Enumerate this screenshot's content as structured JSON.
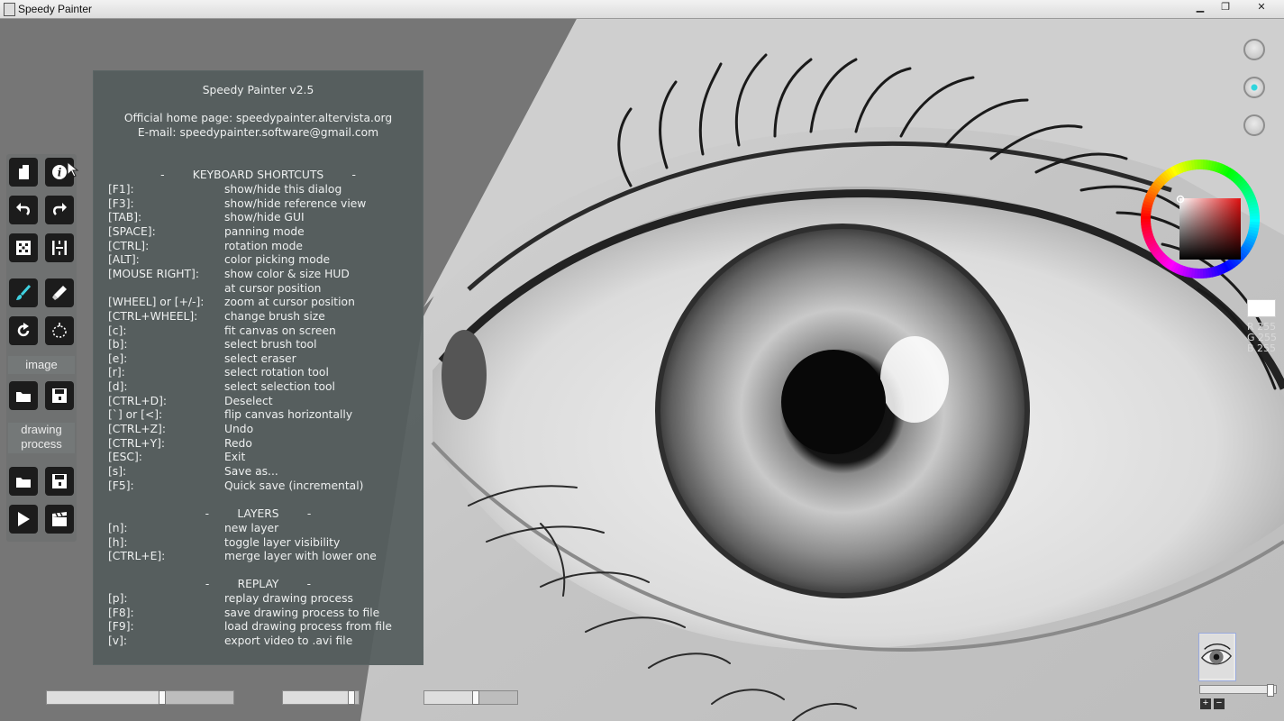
{
  "window": {
    "title": "Speedy Painter",
    "minimize": "▁",
    "restore": "❐",
    "close": "✕"
  },
  "toolbar": {
    "icons": [
      "new-canvas-icon",
      "info-icon",
      "undo-icon",
      "redo-icon",
      "grid-icon",
      "flip-icon",
      "brush-icon",
      "eraser-icon",
      "rotate-icon",
      "lasso-icon",
      "open-image-icon",
      "save-image-icon",
      "open-process-icon",
      "save-process-icon",
      "play-icon",
      "clapper-icon"
    ],
    "image_label": "image",
    "drawing_process_label_1": "drawing",
    "drawing_process_label_2": "process"
  },
  "dialog": {
    "title": "Speedy Painter v2.5",
    "homepage": "Official home page: speedypainter.altervista.org",
    "email": "E-mail: speedypainter.software@gmail.com",
    "keyboard_header": "-        KEYBOARD SHORTCUTS        -",
    "keyboard": [
      {
        "key": "[F1]:",
        "desc": "show/hide this dialog"
      },
      {
        "key": "[F3]:",
        "desc": "show/hide reference view"
      },
      {
        "key": "[TAB]:",
        "desc": "show/hide GUI"
      },
      {
        "key": "[SPACE]:",
        "desc": "panning mode"
      },
      {
        "key": "[CTRL]:",
        "desc": "rotation mode"
      },
      {
        "key": "[ALT]:",
        "desc": "color picking mode"
      },
      {
        "key": "[MOUSE RIGHT]:",
        "desc": "show color & size HUD"
      },
      {
        "key": "",
        "desc": "at cursor position"
      },
      {
        "key": "[WHEEL] or [+/-]:",
        "desc": "zoom at cursor position"
      },
      {
        "key": "[CTRL+WHEEL]:",
        "desc": "change brush size"
      },
      {
        "key": "[c]:",
        "desc": "fit canvas on screen"
      },
      {
        "key": "[b]:",
        "desc": "select brush tool"
      },
      {
        "key": "[e]:",
        "desc": "select eraser"
      },
      {
        "key": "[r]:",
        "desc": "select rotation tool"
      },
      {
        "key": "[d]:",
        "desc": "select selection tool"
      },
      {
        "key": "[CTRL+D]:",
        "desc": "Deselect"
      },
      {
        "key": "[`] or [<]:",
        "desc": "flip canvas horizontally"
      },
      {
        "key": "[CTRL+Z]:",
        "desc": "Undo"
      },
      {
        "key": "[CTRL+Y]:",
        "desc": "Redo"
      },
      {
        "key": "[ESC]:",
        "desc": "Exit"
      },
      {
        "key": "[s]:",
        "desc": "Save as..."
      },
      {
        "key": "[F5]:",
        "desc": "Quick save (incremental)"
      }
    ],
    "layers_header": "-        LAYERS        -",
    "layers": [
      {
        "key": "[n]:",
        "desc": "new layer"
      },
      {
        "key": "[h]:",
        "desc": "toggle layer visibility"
      },
      {
        "key": "[CTRL+E]:",
        "desc": "merge layer with lower one"
      }
    ],
    "replay_header": "-        REPLAY        -",
    "replay": [
      {
        "key": "[p]:",
        "desc": "replay drawing process"
      },
      {
        "key": "[F8]:",
        "desc": "save drawing process to file"
      },
      {
        "key": "[F9]:",
        "desc": "load drawing process from file"
      },
      {
        "key": "[v]:",
        "desc": "export video to .avi file"
      }
    ]
  },
  "sliders": {
    "brush_size": 0.62,
    "opacity": 0.9,
    "flow": 0.55
  },
  "color": {
    "current": "#ffffff",
    "hue_ring": "hue-ring",
    "r_label": "R 255",
    "g_label": "G 255",
    "b_label": "B 255"
  },
  "layers_panel": {
    "zoom_level": 0.95,
    "add": "+",
    "remove": "−"
  }
}
